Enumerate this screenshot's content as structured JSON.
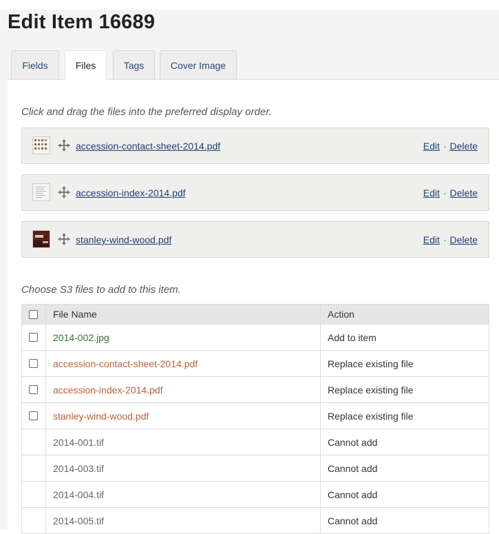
{
  "page": {
    "title": "Edit Item 16689"
  },
  "tabs": [
    {
      "label": "Fields",
      "active": false
    },
    {
      "label": "Files",
      "active": true
    },
    {
      "label": "Tags",
      "active": false
    },
    {
      "label": "Cover Image",
      "active": false
    }
  ],
  "files_section": {
    "hint": "Click and drag the files into the preferred display order.",
    "edit_label": "Edit",
    "delete_label": "Delete",
    "separator": "·",
    "items": [
      {
        "name": "accession-contact-sheet-2014.pdf",
        "thumb_icon": "contact-sheet-thumbnail"
      },
      {
        "name": "accession-index-2014.pdf",
        "thumb_icon": "document-thumbnail"
      },
      {
        "name": "stanley-wind-wood.pdf",
        "thumb_icon": "photo-thumbnail"
      }
    ]
  },
  "s3_section": {
    "hint": "Choose S3 files to add to this item.",
    "headers": {
      "file_name": "File Name",
      "action": "Action"
    },
    "rows": [
      {
        "file": "2014-002.jpg",
        "action": "Add to item",
        "checkbox": true,
        "status": "add"
      },
      {
        "file": "accession-contact-sheet-2014.pdf",
        "action": "Replace existing file",
        "checkbox": true,
        "status": "replace"
      },
      {
        "file": "accession-index-2014.pdf",
        "action": "Replace existing file",
        "checkbox": true,
        "status": "replace"
      },
      {
        "file": "stanley-wind-wood.pdf",
        "action": "Replace existing file",
        "checkbox": true,
        "status": "replace"
      },
      {
        "file": "2014-001.tif",
        "action": "Cannot add",
        "checkbox": false,
        "status": "none"
      },
      {
        "file": "2014-003.tif",
        "action": "Cannot add",
        "checkbox": false,
        "status": "none"
      },
      {
        "file": "2014-004.tif",
        "action": "Cannot add",
        "checkbox": false,
        "status": "none"
      },
      {
        "file": "2014-005.tif",
        "action": "Cannot add",
        "checkbox": false,
        "status": "none"
      }
    ]
  },
  "colors": {
    "link": "#1d3f73",
    "add": "#2a7a2a",
    "replace": "#b9613c",
    "disabled": "#666666"
  }
}
